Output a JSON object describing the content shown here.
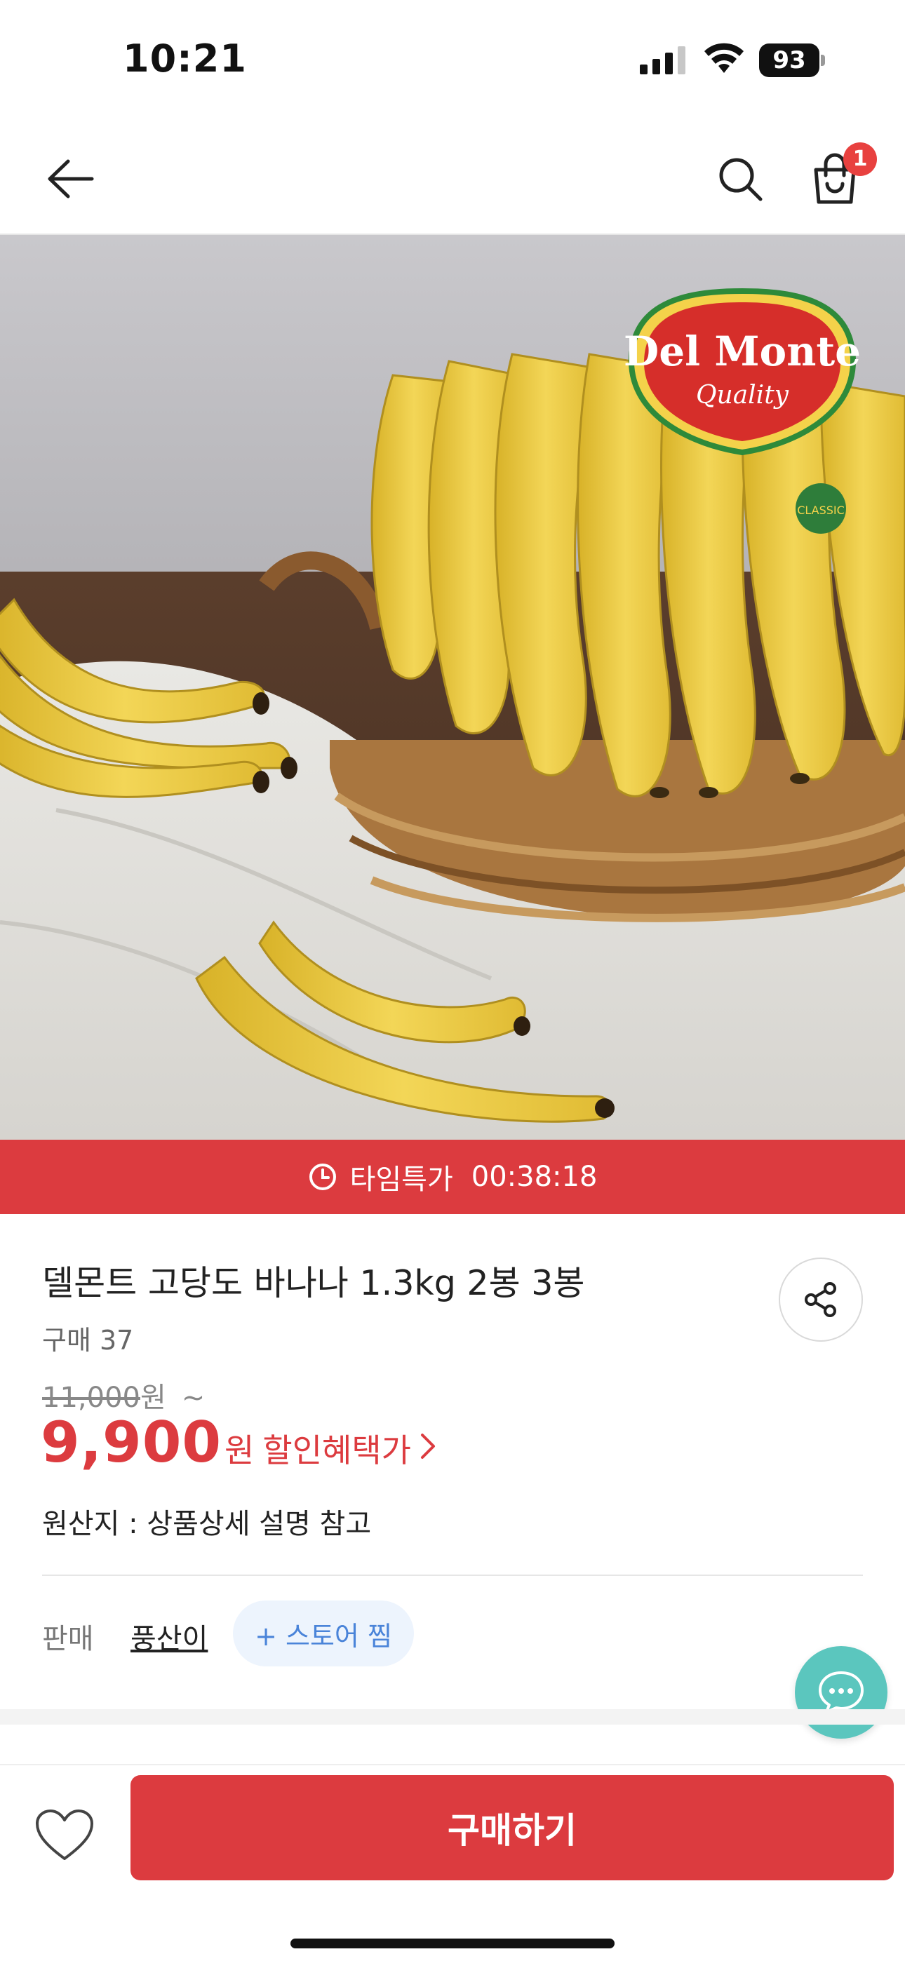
{
  "status_bar": {
    "time": "10:21",
    "battery": "93"
  },
  "header": {
    "cart_count": "1"
  },
  "hero": {
    "brand_logo_text": "Del Monte",
    "brand_logo_sub": "Quality",
    "sticker_text": "CLASSIC"
  },
  "timedeal": {
    "label": "타임특가",
    "countdown": "00:38:18"
  },
  "product": {
    "title": "델몬트 고당도 바나나 1.3kg 2봉 3봉",
    "purchase_count": "구매 37",
    "original_price": "11,000",
    "original_price_unit": "원",
    "original_price_suffix": "~",
    "sale_price": "9,900",
    "sale_price_unit": "원",
    "discount_link": "할인혜택가",
    "origin": "원산지 : 상품상세 설명 참고"
  },
  "seller": {
    "label": "판매",
    "name": "풍산이",
    "favorite_button": "+ 스토어 찜"
  },
  "bottom": {
    "buy_button": "구매하기"
  },
  "colors": {
    "accent_red": "#dc3b3f",
    "chat_teal": "#5bc6be",
    "store_blue": "#4a84d9"
  }
}
